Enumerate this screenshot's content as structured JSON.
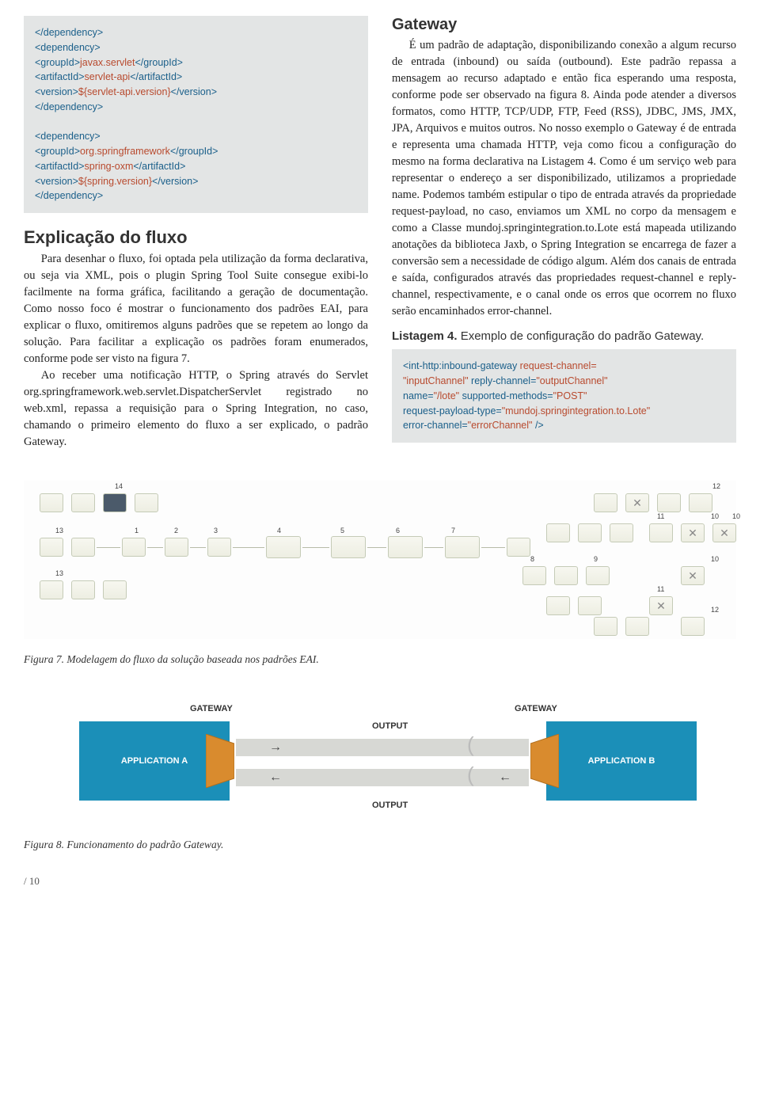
{
  "left": {
    "code1": {
      "l1": "</dependency>",
      "l2": "<dependency>",
      "l3": "   <groupId>",
      "l3v": "javax.servlet",
      "l3e": "</groupId>",
      "l4": "   <artifactId>",
      "l4v": "servlet-api",
      "l4e": "</artifactId>",
      "l5": "   <version>",
      "l5v": "${servlet-api.version}",
      "l5e": "</version>",
      "l6": "</dependency>",
      "l7": "",
      "l8": "<dependency>",
      "l9": "   <groupId>",
      "l9v": "org.springframework",
      "l9e": "</groupId>",
      "l10": "   <artifactId>",
      "l10v": "spring-oxm",
      "l10e": "</artifactId>",
      "l11": "   <version>",
      "l11v": "${spring.version}",
      "l11e": "</version>",
      "l12": "</dependency>"
    },
    "h2": "Explicação do fluxo",
    "p1": "Para desenhar o fluxo, foi optada pela utilização da forma declarativa, ou seja via XML, pois o plugin Spring Tool Suite consegue exibi-lo facilmente na forma gráfica, facilitando a geração de documentação. Como nosso foco é mostrar o funcionamento dos padrões EAI, para explicar o fluxo, omitiremos alguns padrões que se repetem ao longo da solução. Para facilitar a explicação os padrões foram enumerados, conforme pode ser visto na figura 7.",
    "p2": "Ao receber uma notificação HTTP, o Spring através do Servlet org.springframework.web.servlet.DispatcherServlet registrado no web.xml, repassa a requisição para o Spring Integration, no caso, chamando o primeiro elemento do fluxo a ser explicado, o padrão Gateway."
  },
  "right": {
    "h3": "Gateway",
    "p1": "É um padrão de adaptação, disponibilizando conexão a algum recurso de entrada (inbound) ou saída (outbound). Este padrão repassa a mensagem ao recurso adaptado e então fica esperando uma resposta, conforme pode ser observado na figura 8. Ainda pode atender a diversos formatos, como HTTP, TCP/UDP, FTP, Feed (RSS), JDBC, JMS, JMX, JPA, Arquivos e muitos outros. No nosso exemplo o Gateway é de entrada e representa uma chamada HTTP, veja como ficou a configuração do mesmo na forma declarativa na Listagem 4. Como é um serviço web para representar o endereço a ser disponibilizado, utilizamos a propriedade name. Podemos também estipular o tipo de entrada através da propriedade request-payload, no caso, enviamos um XML no corpo da mensagem e como a Classe mundoj.springintegration.to.Lote está mapeada utilizando anotações da biblioteca Jaxb, o Spring Integration se encarrega de fazer a conversão sem a necessidade de código algum. Além dos canais de entrada e saída, configurados através das propriedades request-channel e reply-channel, respectivamente, e o canal onde os erros que ocorrem no fluxo serão encaminhados error-channel.",
    "listing_b": "Listagem 4.",
    "listing_t": " Exemplo de configuração do padrão Gateway.",
    "code2": {
      "l1a": "<int-http:inbound-gateway ",
      "l1b": "request-channel=",
      "l2a": "\"inputChannel\" ",
      "l2b": "reply-channel=",
      "l2c": "\"outputChannel\"",
      "l3a": "  name=",
      "l3b": "\"/lote\" ",
      "l3c": "supported-methods=",
      "l3d": "\"POST\"",
      "l4a": "  request-payload-type=",
      "l4b": "\"mundoj.springintegration.to.Lote\"",
      "l5a": "  error-channel=",
      "l5b": "\"errorChannel\" ",
      "l5c": "/>"
    }
  },
  "fig7_caption": "Figura 7. Modelagem do fluxo da solução baseada nos padrões EAI.",
  "fig8_caption": "Figura 8. Funcionamento do padrão Gateway.",
  "d7_nums": [
    "14",
    "13",
    "1",
    "2",
    "3",
    "4",
    "5",
    "6",
    "7",
    "8",
    "9",
    "10",
    "10",
    "11",
    "11",
    "12",
    "12",
    "13"
  ],
  "d8": {
    "gw": "GATEWAY",
    "out": "OUTPUT",
    "appA": "APPLICATION A",
    "appB": "APPLICATION B"
  },
  "page": "/ 10"
}
